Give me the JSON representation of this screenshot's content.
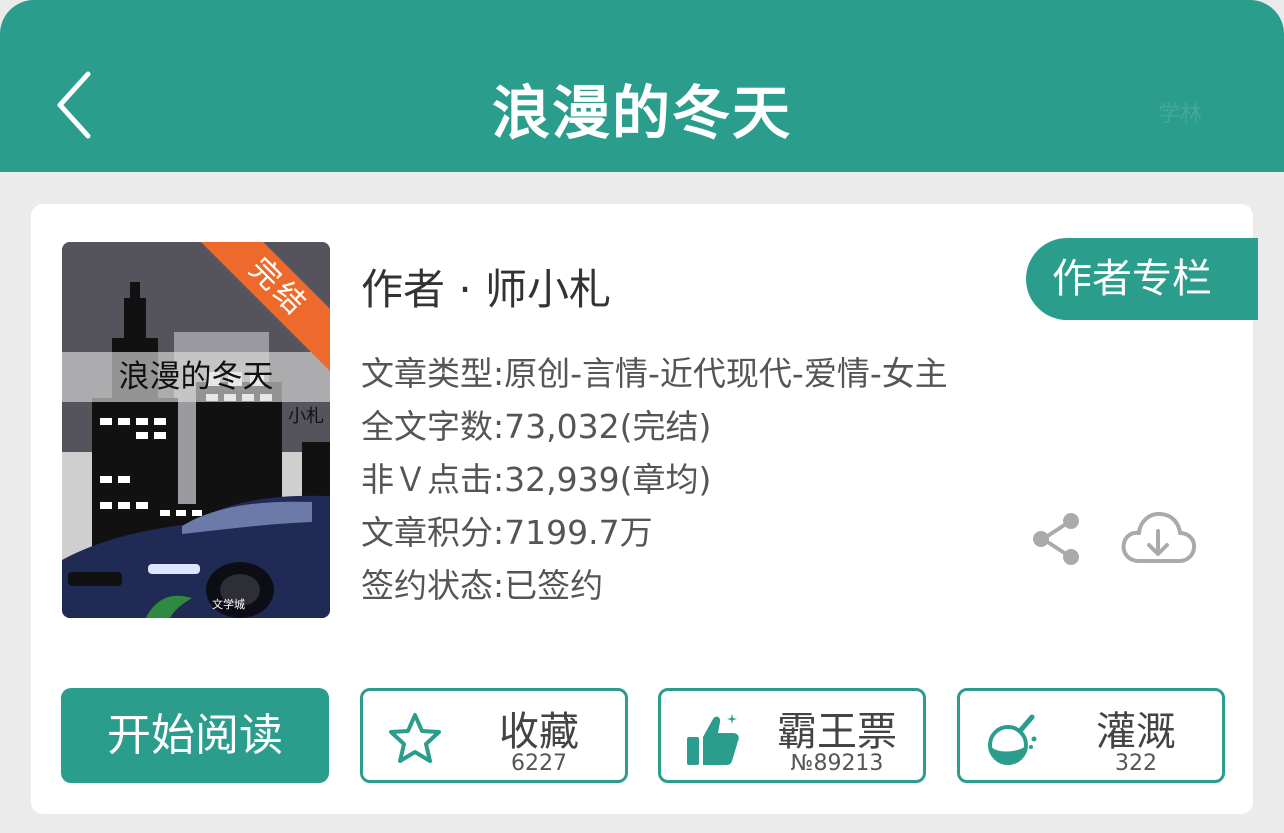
{
  "colors": {
    "accent": "#2a9d8c",
    "ribbon": "#ee6a2c",
    "background": "#ebebeb"
  },
  "header": {
    "title": "浪漫的冬天",
    "back_icon": "chevron-left-icon",
    "faint_label": "学林"
  },
  "cover": {
    "title": "浪漫的冬天",
    "author_fragment": "小札",
    "ribbon": "完结",
    "watermark": "文学城"
  },
  "book": {
    "author": "作者 · 师小札",
    "author_column_button": "作者专栏",
    "info": [
      "文章类型:原创-言情-近代现代-爱情-女主",
      "全文字数:73,032(完结)",
      "非Ｖ点击:32,939(章均)",
      "文章积分:7199.7万",
      "签约状态:已签约"
    ],
    "share_icon": "share-icon",
    "download_icon": "cloud-download-icon"
  },
  "actions": {
    "read_button": "开始阅读",
    "favorite": {
      "label": "收藏",
      "count": "6227",
      "icon": "star-icon"
    },
    "ticket": {
      "label": "霸王票",
      "count": "№89213",
      "icon": "thumbs-up-icon"
    },
    "nutrient": {
      "label": "灌溉",
      "count": "322",
      "icon": "flask-icon"
    }
  }
}
